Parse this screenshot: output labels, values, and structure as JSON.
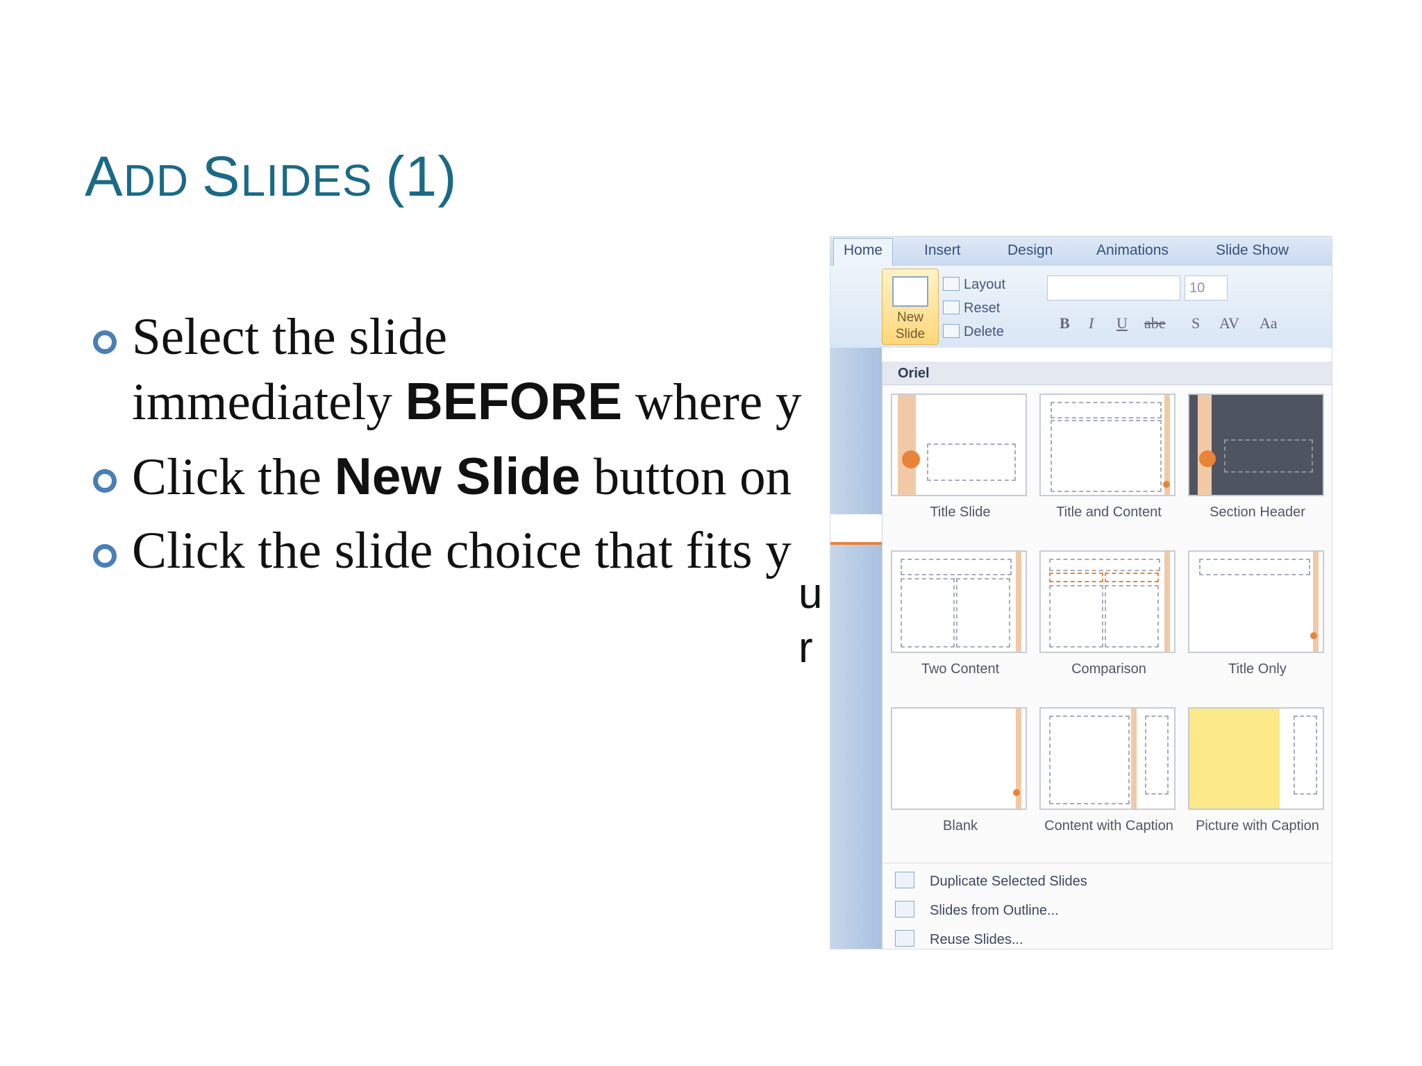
{
  "slide": {
    "title_part1_big": "A",
    "title_part1_small": "DD ",
    "title_part2_big": "S",
    "title_part2_small": "LIDES ",
    "title_part3": "(1)",
    "bullets": [
      {
        "pre": "Select the slide",
        "line2_pre": "immediately ",
        "bold": "BEFORE",
        "post": " where y"
      },
      {
        "pre": "Click the ",
        "bold": "New Slide",
        "post": " button on"
      },
      {
        "pre": "Click the slide choice that fits y",
        "bold": "",
        "post": ""
      }
    ],
    "overflow_letters": [
      "u",
      "r"
    ]
  },
  "ppt": {
    "tabs": [
      "Home",
      "Insert",
      "Design",
      "Animations",
      "Slide Show"
    ],
    "new_slide_label": "New Slide",
    "commands": [
      "Layout",
      "Reset",
      "Delete"
    ],
    "font_size": "10",
    "format_buttons": [
      "B",
      "I",
      "U",
      "abe",
      "S",
      "AV",
      "Aa"
    ],
    "theme_name": "Oriel",
    "layouts": [
      "Title Slide",
      "Title and Content",
      "Section Header",
      "Two Content",
      "Comparison",
      "Title Only",
      "Blank",
      "Content with Caption",
      "Picture with Caption"
    ],
    "menu_items": [
      "Duplicate Selected Slides",
      "Slides from Outline...",
      "Reuse Slides..."
    ]
  },
  "colors": {
    "title": "#1a6a86",
    "bullet": "#4a7fb5",
    "accent": "#e8833a"
  }
}
